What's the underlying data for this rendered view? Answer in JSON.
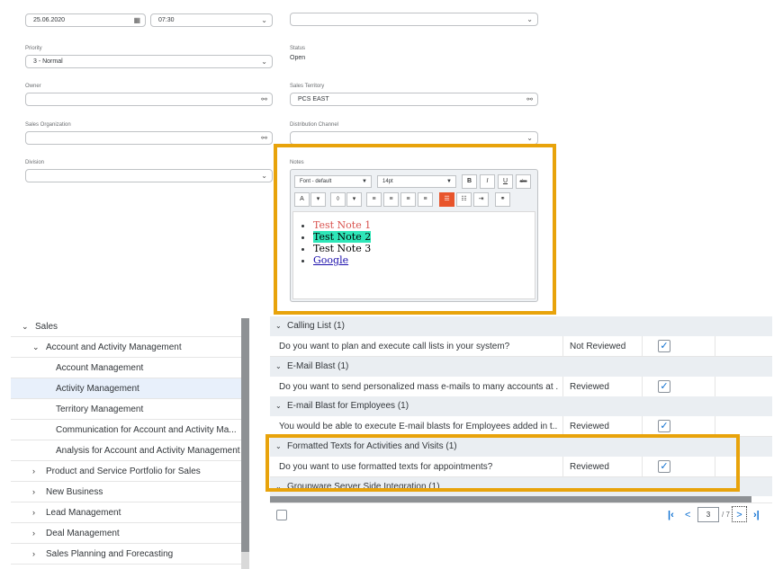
{
  "form": {
    "date_value": "25.06.2020",
    "time_value": "07:30",
    "priority_label": "Priority",
    "priority_value": "3 - Normal",
    "status_label": "Status",
    "status_value": "Open",
    "owner_label": "Owner",
    "owner_value": "",
    "sales_territory_label": "Sales Territory",
    "sales_territory_value": "PCS EAST",
    "sales_org_label": "Sales Organization",
    "sales_org_value": "",
    "dist_channel_label": "Distribution Channel",
    "dist_channel_value": "",
    "division_label": "Division",
    "division_value": "",
    "notes_label": "Notes"
  },
  "editor": {
    "font_select": "Font - default",
    "size_select": "14pt",
    "bold": "B",
    "italic": "I",
    "underline": "U",
    "strike": "abc",
    "font_color": "A",
    "notes": [
      "Test Note 1",
      "Test Note 2",
      "Test Note 3",
      "Google"
    ]
  },
  "tree": {
    "items": [
      {
        "label": "Sales",
        "chevron": "v"
      },
      {
        "label": "Account and Activity Management",
        "chevron": "v"
      },
      {
        "label": "Account Management",
        "chevron": ""
      },
      {
        "label": "Activity Management",
        "chevron": ""
      },
      {
        "label": "Territory Management",
        "chevron": ""
      },
      {
        "label": "Communication for Account and Activity Ma...",
        "chevron": ""
      },
      {
        "label": "Analysis for Account and Activity Management",
        "chevron": ""
      },
      {
        "label": "Product and Service Portfolio for Sales",
        "chevron": ">"
      },
      {
        "label": "New Business",
        "chevron": ">"
      },
      {
        "label": "Lead Management",
        "chevron": ">"
      },
      {
        "label": "Deal Management",
        "chevron": ">"
      },
      {
        "label": "Sales Planning and Forecasting",
        "chevron": ">"
      }
    ]
  },
  "table": {
    "groups": [
      {
        "title": "Calling List (1)",
        "question": "Do you want to plan and execute call lists in your system?",
        "status": "Not Reviewed",
        "checked": "✓"
      },
      {
        "title": "E-Mail Blast (1)",
        "question": "Do you want to send personalized mass e-mails to many accounts at ...",
        "status": "Reviewed",
        "checked": "✓"
      },
      {
        "title": "E-mail Blast for Employees (1)",
        "question": "You would be able to execute E-mail blasts for Employees added in t...",
        "status": "Reviewed",
        "checked": "✓"
      },
      {
        "title": "Formatted Texts for Activities and Visits (1)",
        "question": "Do you want to use formatted texts for appointments?",
        "status": "Reviewed",
        "checked": "✓"
      }
    ],
    "partial_group": "Groupware Server Side Integration (1)"
  },
  "pagination": {
    "first": "K",
    "prev": "<",
    "page": "3",
    "total": "/ 7",
    "next": ">",
    "last": "K"
  },
  "colors": {
    "highlight": "#e8a30b",
    "active_button": "#e8542b",
    "note_highlight": "#2ee6b8"
  }
}
